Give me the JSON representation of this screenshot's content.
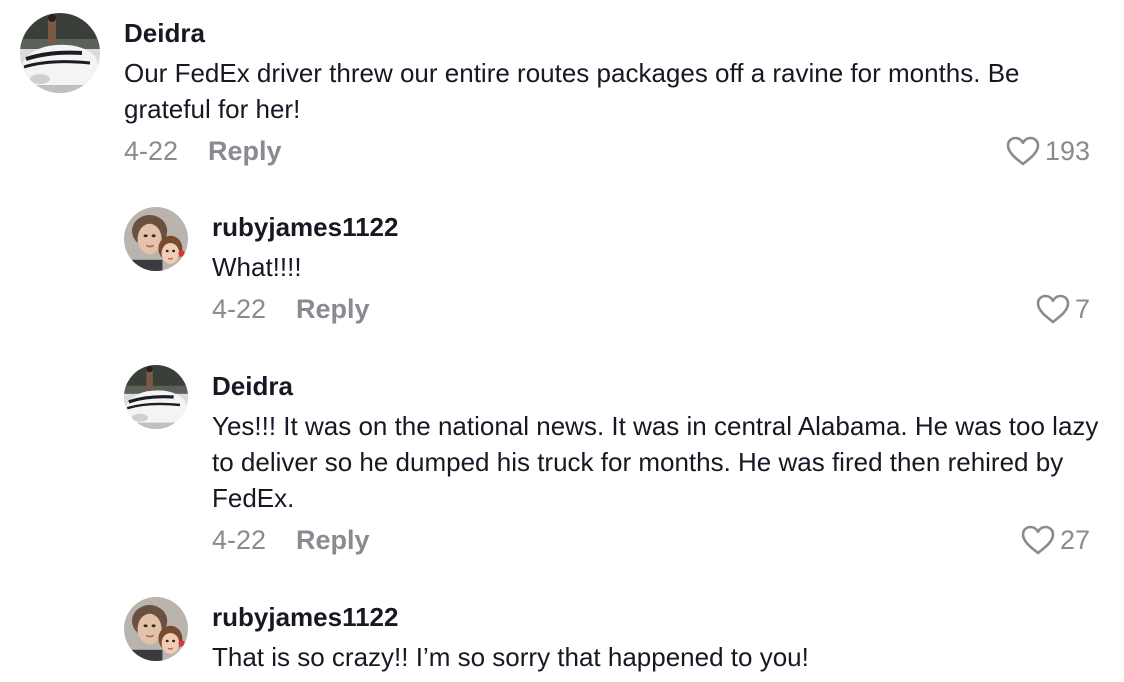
{
  "comments": [
    {
      "username": "Deidra",
      "avatar": "car-photo-avatar",
      "text": "Our FedEx driver threw our entire routes packages off a ravine for months. Be grateful for her!",
      "date": "4-22",
      "reply_label": "Reply",
      "likes": "193"
    },
    {
      "username": "rubyjames1122",
      "avatar": "selfie-photo-avatar",
      "text": "What!!!!",
      "date": "4-22",
      "reply_label": "Reply",
      "likes": "7"
    },
    {
      "username": "Deidra",
      "avatar": "car-photo-avatar",
      "text": "Yes!!! It was on the national news. It was in central Alabama. He was too lazy to deliver so he dumped his truck for months. He was fired then rehired by FedEx.",
      "date": "4-22",
      "reply_label": "Reply",
      "likes": "27"
    },
    {
      "username": "rubyjames1122",
      "avatar": "selfie-photo-avatar",
      "text": "That is so crazy!! I’m so sorry that happened to you!"
    }
  ],
  "colors": {
    "text": "#161823",
    "secondary": "#8a8b91",
    "background": "#ffffff"
  },
  "icons": {
    "like": "heart-outline-icon"
  }
}
